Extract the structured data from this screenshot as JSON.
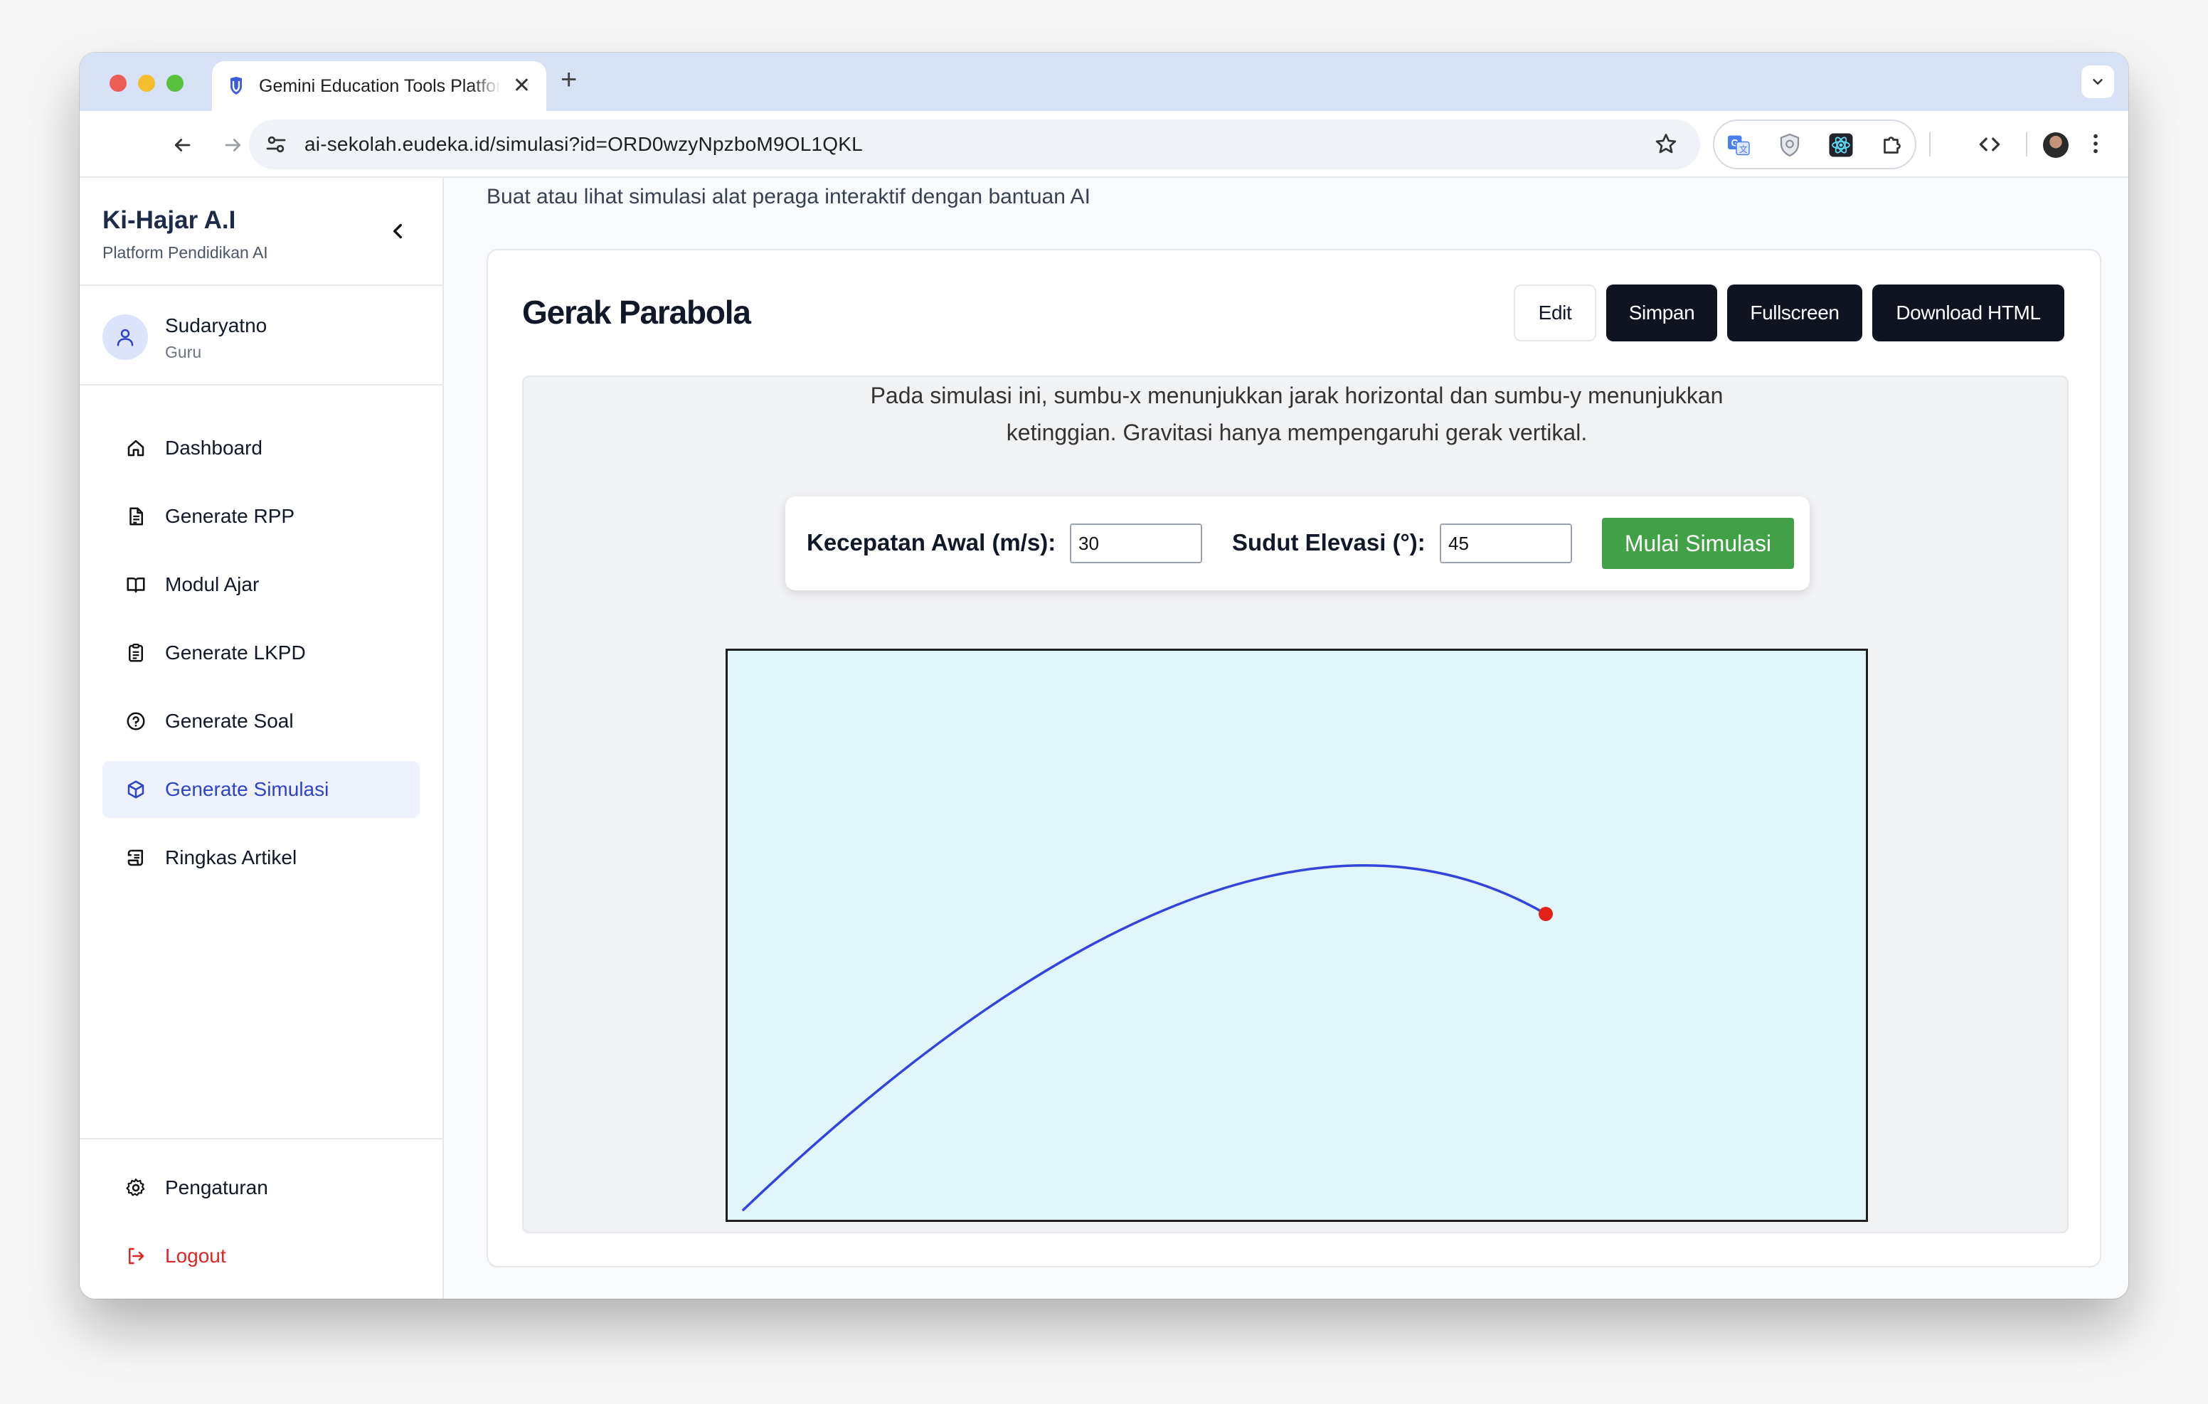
{
  "browser": {
    "tab_title": "Gemini Education Tools Platform",
    "url": "ai-sekolah.eudeka.id/simulasi?id=ORD0wzyNpzboM9OL1QKL"
  },
  "sidebar": {
    "brand_title": "Ki-Hajar A.I",
    "brand_subtitle": "Platform Pendidikan AI",
    "user": {
      "name": "Sudaryatno",
      "role": "Guru"
    },
    "items": [
      {
        "label": "Dashboard",
        "icon": "home-icon"
      },
      {
        "label": "Generate RPP",
        "icon": "file-text-icon"
      },
      {
        "label": "Modul Ajar",
        "icon": "book-open-icon"
      },
      {
        "label": "Generate LKPD",
        "icon": "clipboard-icon"
      },
      {
        "label": "Generate Soal",
        "icon": "help-circle-icon"
      },
      {
        "label": "Generate Simulasi",
        "icon": "box-icon",
        "active": true
      },
      {
        "label": "Ringkas Artikel",
        "icon": "scroll-icon"
      }
    ],
    "bottom_items": [
      {
        "label": "Pengaturan",
        "icon": "settings-icon"
      },
      {
        "label": "Logout",
        "icon": "logout-icon"
      }
    ]
  },
  "main": {
    "page_description": "Buat atau lihat simulasi alat peraga interaktif dengan bantuan AI",
    "card_title": "Gerak Parabola",
    "buttons": {
      "edit": "Edit",
      "save": "Simpan",
      "fullscreen": "Fullscreen",
      "download": "Download HTML"
    },
    "simulation": {
      "description_line1": "Pada simulasi ini, sumbu-x menunjukkan jarak horizontal dan sumbu-y menunjukkan",
      "description_line2": "ketinggian. Gravitasi hanya mempengaruhi gerak vertikal.",
      "velocity_label": "Kecepatan Awal (m/s):",
      "velocity_value": "30",
      "angle_label": "Sudut Elevasi (°):",
      "angle_value": "45",
      "start_button": "Mulai Simulasi",
      "trajectory_color": "#3344dd",
      "projectile_color": "#e3221c",
      "canvas_bg": "#e0f6fb"
    }
  },
  "colors": {
    "accent": "#2b44c8",
    "dark_button": "#0f1420",
    "start_button": "#42a046",
    "logout": "#dc2626"
  }
}
